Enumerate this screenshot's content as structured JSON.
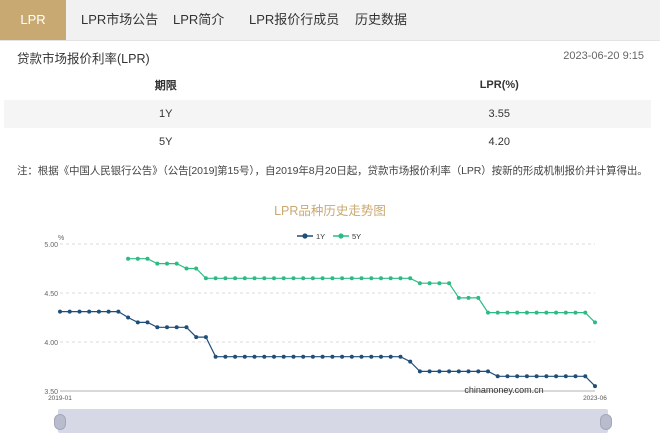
{
  "tabs": [
    {
      "label": "LPR",
      "active": true
    },
    {
      "label": "LPR市场公告",
      "active": false
    },
    {
      "label": "LPR简介",
      "active": false
    },
    {
      "label": "LPR报价行成员",
      "active": false
    },
    {
      "label": "历史数据",
      "active": false
    }
  ],
  "section": {
    "title": "贷款市场报价利率(LPR)",
    "updated": "2023-06-20 9:15"
  },
  "table": {
    "headers": [
      "期限",
      "LPR(%)"
    ],
    "rows": [
      {
        "term": "1Y",
        "rate": "3.55"
      },
      {
        "term": "5Y",
        "rate": "4.20"
      }
    ]
  },
  "note": "注：根据《中国人民银行公告》（公告[2019]第15号），自2019年8月20日起，贷款市场报价利率（LPR）按新的形成机制报价并计算得出。",
  "chart_data": {
    "type": "line",
    "title": "LPR品种历史走势图",
    "ylabel": "%",
    "ylim": [
      3.5,
      5.0
    ],
    "y_ticks": [
      "3.50",
      "4.00",
      "4.50",
      "5.00"
    ],
    "x_tick_labels": [
      "2019-01",
      "2023-06"
    ],
    "legend": "top-center",
    "grid": true,
    "watermark": "chinamoney.com.cn",
    "colors": {
      "1Y": "#1f4e79",
      "5Y": "#2dbb84"
    },
    "series": [
      {
        "name": "1Y",
        "values": [
          4.31,
          4.31,
          4.31,
          4.31,
          4.31,
          4.31,
          4.31,
          4.25,
          4.2,
          4.2,
          4.15,
          4.15,
          4.15,
          4.15,
          4.05,
          4.05,
          3.85,
          3.85,
          3.85,
          3.85,
          3.85,
          3.85,
          3.85,
          3.85,
          3.85,
          3.85,
          3.85,
          3.85,
          3.85,
          3.85,
          3.85,
          3.85,
          3.85,
          3.85,
          3.85,
          3.85,
          3.8,
          3.7,
          3.7,
          3.7,
          3.7,
          3.7,
          3.7,
          3.7,
          3.7,
          3.65,
          3.65,
          3.65,
          3.65,
          3.65,
          3.65,
          3.65,
          3.65,
          3.65,
          3.65,
          3.55
        ]
      },
      {
        "name": "5Y",
        "values": [
          null,
          null,
          null,
          null,
          null,
          null,
          null,
          4.85,
          4.85,
          4.85,
          4.8,
          4.8,
          4.8,
          4.75,
          4.75,
          4.65,
          4.65,
          4.65,
          4.65,
          4.65,
          4.65,
          4.65,
          4.65,
          4.65,
          4.65,
          4.65,
          4.65,
          4.65,
          4.65,
          4.65,
          4.65,
          4.65,
          4.65,
          4.65,
          4.65,
          4.65,
          4.65,
          4.6,
          4.6,
          4.6,
          4.6,
          4.45,
          4.45,
          4.45,
          4.3,
          4.3,
          4.3,
          4.3,
          4.3,
          4.3,
          4.3,
          4.3,
          4.3,
          4.3,
          4.3,
          4.2
        ]
      }
    ]
  }
}
